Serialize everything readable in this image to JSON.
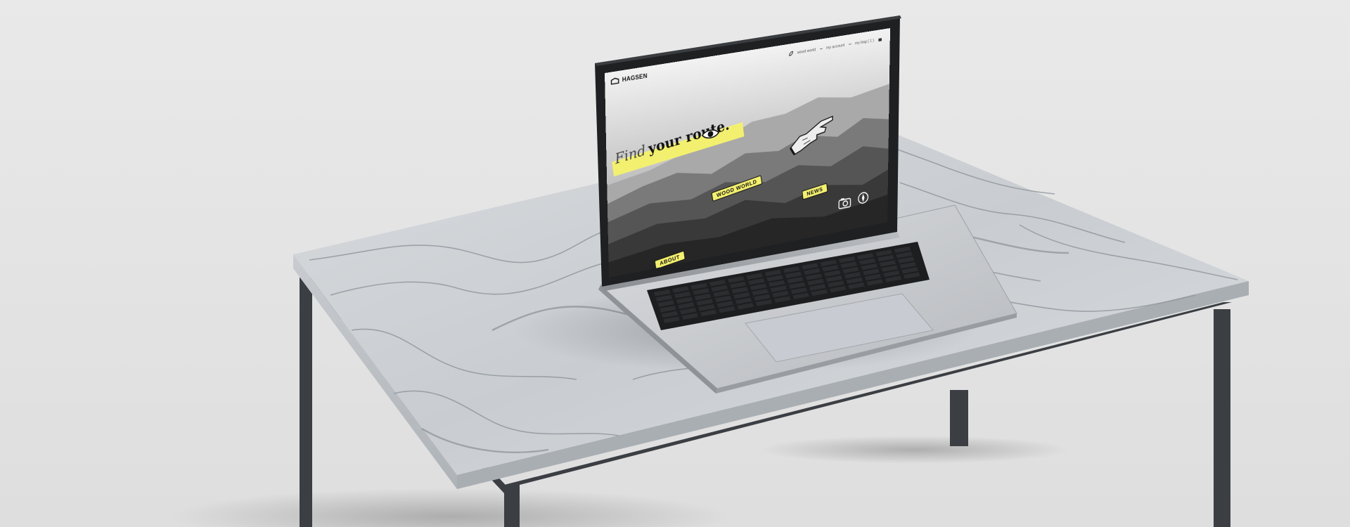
{
  "site": {
    "brand": "HAGSEN",
    "nav": {
      "wood_world": "wood world",
      "account": "my account",
      "bag": "my bag ( 1 )"
    },
    "heading": {
      "part1": "Find",
      "part2": "your route."
    },
    "tags": {
      "wood_world": "WOOD WORLD",
      "news": "NEWS",
      "about": "ABOUT"
    },
    "accent_color": "#f3f070"
  },
  "icons": [
    "logo-icon",
    "bag-icon",
    "eye-icon",
    "pointing-hand-icon",
    "camera-icon",
    "compass-icon"
  ]
}
